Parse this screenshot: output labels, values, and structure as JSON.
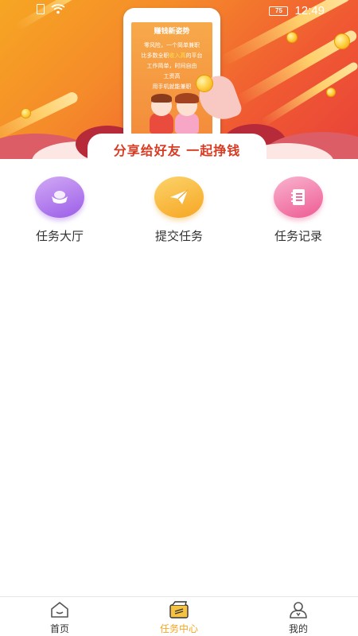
{
  "status_bar": {
    "battery": "75",
    "time": "12:49"
  },
  "banner": {
    "phone_title": "赚钱新姿势",
    "phone_lines": [
      "零风险，一个简单兼职",
      "比多数全职收入高的平台",
      "工作简单，时间自由",
      "工资高",
      "用手机就能兼职"
    ],
    "phone_line_highlight": "收入高",
    "slogan": "分享给好友  一起挣钱"
  },
  "entries": [
    {
      "label": "任务大厅",
      "icon": "ingot-icon",
      "color_from": "#c79bf2",
      "color_to": "#9b5de8"
    },
    {
      "label": "提交任务",
      "icon": "paper-plane-icon",
      "color_from": "#fcd36a",
      "color_to": "#f6a623"
    },
    {
      "label": "任务记录",
      "icon": "notebook-icon",
      "color_from": "#f7a6c6",
      "color_to": "#ee5b93"
    }
  ],
  "tabbar": {
    "items": [
      {
        "label": "首页",
        "icon": "home-icon",
        "active": false
      },
      {
        "label": "任务中心",
        "icon": "task-center-icon",
        "active": true
      },
      {
        "label": "我的",
        "icon": "profile-icon",
        "active": false
      }
    ],
    "active_color": "#f5a623",
    "inactive_color": "#333333"
  }
}
